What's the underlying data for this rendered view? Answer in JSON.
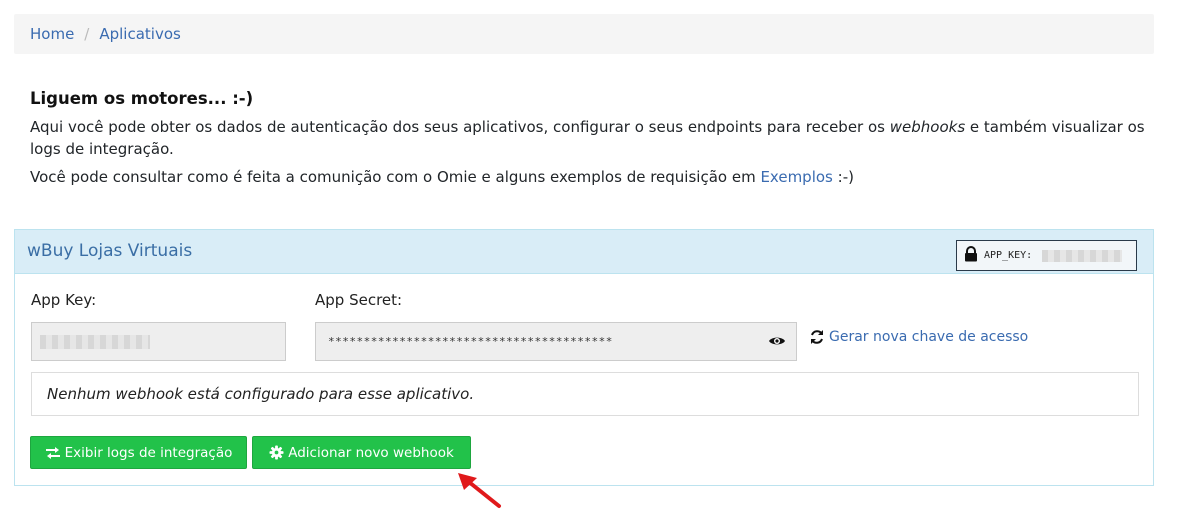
{
  "breadcrumb": {
    "home": "Home",
    "separator": "/",
    "current": "Aplicativos"
  },
  "intro": {
    "heading": "Liguem os motores... :-)",
    "line1_part1": "Aqui você pode obter os dados de autenticação dos seus aplicativos, configurar o seus endpoints para receber os ",
    "line1_em": "webhooks",
    "line1_part2": " e também visualizar os logs de integração.",
    "line2_part1": "Você pode consultar como é feita a comunição com o Omie e alguns exemplos de requisição em ",
    "line2_link": "Exemplos",
    "line2_part2": " :-)"
  },
  "panel": {
    "title": "wBuy Lojas Virtuais",
    "badge_label": "APP_KEY:",
    "app_key_label": "App Key:",
    "app_secret_label": "App Secret:",
    "app_secret_value": "****************************************",
    "regenerate_label": "Gerar nova chave de acesso",
    "no_webhook_message": "Nenhum webhook está configurado para esse aplicativo.",
    "logs_button": "Exibir logs de integração",
    "add_webhook_button": "Adicionar novo webhook"
  },
  "icons": {
    "badge": "lock-icon",
    "secret_toggle": "eye-icon",
    "regenerate": "refresh-icon",
    "logs": "exchange-arrows-icon",
    "add": "gear-icon",
    "annotation": "red-arrow-icon"
  },
  "colors": {
    "link": "#3a6bb0",
    "panel_header": "#d9edf7",
    "button_green": "#22c24a",
    "arrow_red": "#e0191b"
  }
}
